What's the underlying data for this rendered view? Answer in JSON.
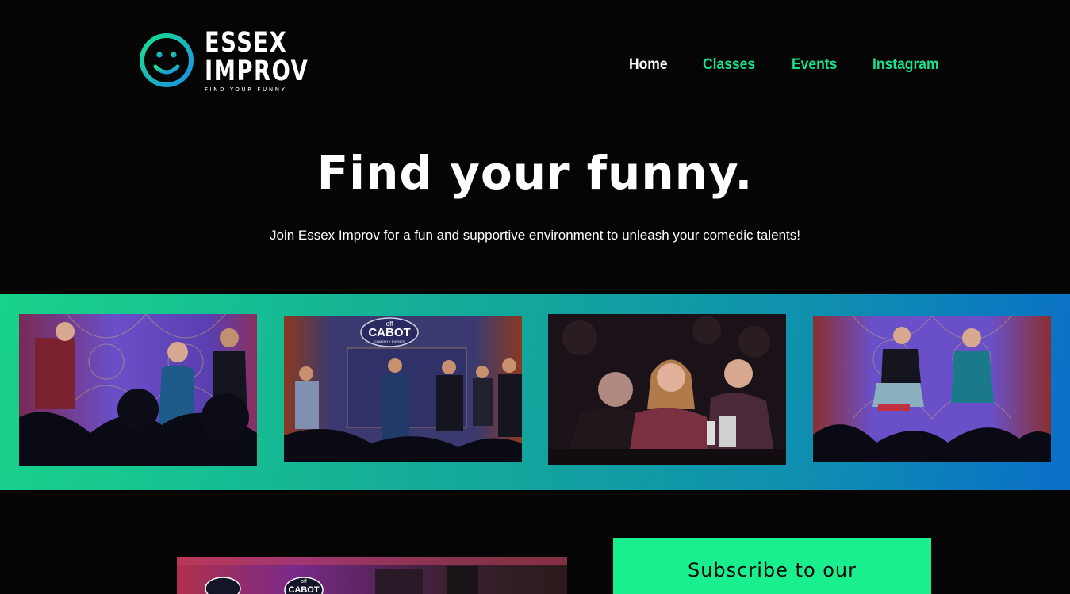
{
  "brand": {
    "logo_line1": "ESSEX",
    "logo_line2": "IMPROV",
    "logo_tagline": "FIND YOUR FUNNY",
    "logo_icon": "smiley-face-icon",
    "accent_green": "#19e08d",
    "accent_blue": "#0a6fc8"
  },
  "nav": {
    "items": [
      {
        "label": "Home",
        "active": true
      },
      {
        "label": "Classes",
        "active": false
      },
      {
        "label": "Events",
        "active": false
      },
      {
        "label": "Instagram",
        "active": false
      }
    ]
  },
  "hero": {
    "title": "Find your funny.",
    "subtitle": "Join Essex Improv for a fun and supportive environment to unleash your comedic talents!"
  },
  "gallery": {
    "photos": [
      {
        "name": "improv-performers-photo"
      },
      {
        "name": "stage-group-photo",
        "sign_line1": "off",
        "sign_line2": "CABOT",
        "sign_line3": "COMEDY + EVENTS"
      },
      {
        "name": "audience-laughing-photo"
      },
      {
        "name": "stage-scene-photo"
      }
    ]
  },
  "lower": {
    "venue_photo": "venue-photo",
    "venue_sign_line1": "off",
    "venue_sign_line2": "CABOT",
    "subscribe_text": "Subscribe to our"
  }
}
